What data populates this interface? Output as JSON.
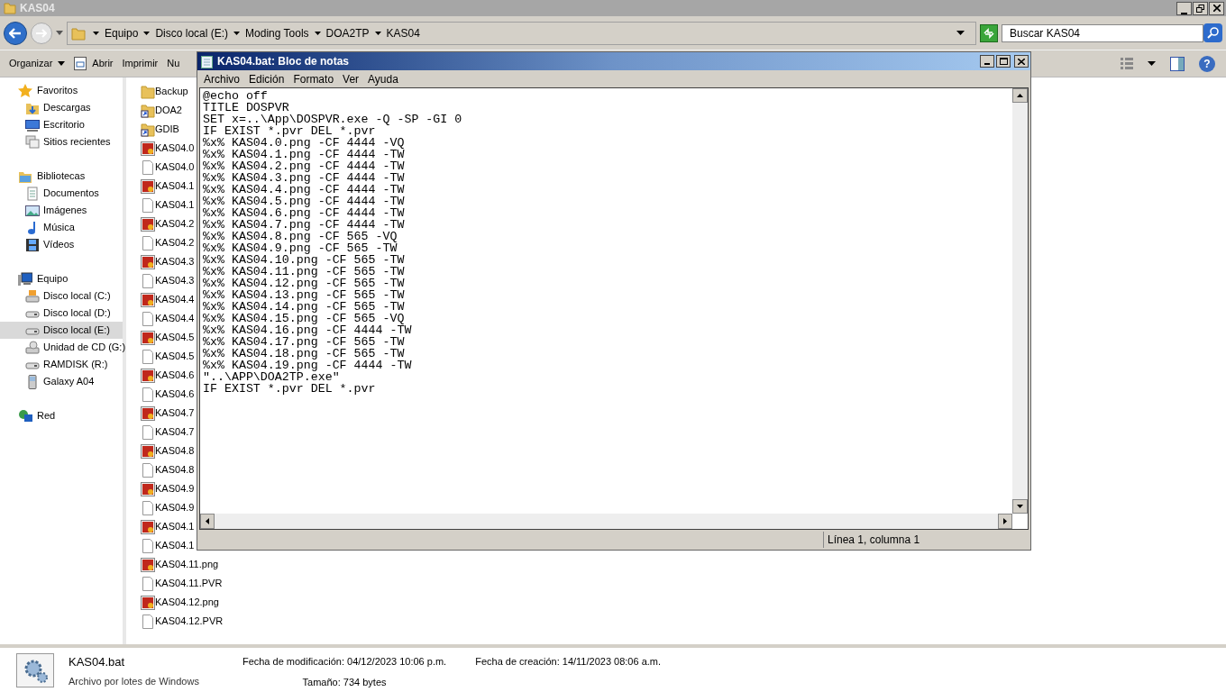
{
  "window": {
    "title": "KAS04"
  },
  "address_bar": {
    "crumbs": [
      "Equipo",
      "Disco local (E:)",
      "Moding Tools",
      "DOA2TP",
      "KAS04"
    ]
  },
  "search": {
    "placeholder": "Buscar KAS04"
  },
  "toolbar": {
    "items": [
      "Organizar",
      "Abrir",
      "Imprimir",
      "Nu"
    ],
    "help_button": "?"
  },
  "sidebar": {
    "groups": [
      {
        "label": "Favoritos",
        "kind": "star",
        "children": [
          {
            "label": "Descargas",
            "kind": "downloads",
            "selected": false
          },
          {
            "label": "Escritorio",
            "kind": "desktop",
            "selected": false
          },
          {
            "label": "Sitios recientes",
            "kind": "recent",
            "selected": false
          }
        ]
      },
      {
        "label": "Bibliotecas",
        "kind": "library",
        "children": [
          {
            "label": "Documentos",
            "kind": "docs",
            "selected": false
          },
          {
            "label": "Imágenes",
            "kind": "pictures",
            "selected": false
          },
          {
            "label": "Música",
            "kind": "music",
            "selected": false
          },
          {
            "label": "Vídeos",
            "kind": "video",
            "selected": false
          }
        ]
      },
      {
        "label": "Equipo",
        "kind": "computer",
        "children": [
          {
            "label": "Disco local (C:)",
            "kind": "sysdrive",
            "selected": false
          },
          {
            "label": "Disco local (D:)",
            "kind": "drive",
            "selected": false
          },
          {
            "label": "Disco local (E:)",
            "kind": "drive",
            "selected": true
          },
          {
            "label": "Unidad de CD (G:)",
            "kind": "cd",
            "selected": false
          },
          {
            "label": "RAMDISK (R:)",
            "kind": "drive",
            "selected": false
          },
          {
            "label": "Galaxy A04",
            "kind": "phone",
            "selected": false
          }
        ]
      },
      {
        "label": "Red",
        "kind": "network"
      }
    ]
  },
  "files": [
    {
      "name": "Backup",
      "kind": "folder"
    },
    {
      "name": "DOA2",
      "kind": "shortcut"
    },
    {
      "name": "GDIB",
      "kind": "shortcut"
    },
    {
      "name": "KAS04.0",
      "kind": "image"
    },
    {
      "name": "KAS04.0",
      "kind": "file"
    },
    {
      "name": "KAS04.1",
      "kind": "image"
    },
    {
      "name": "KAS04.1",
      "kind": "file"
    },
    {
      "name": "KAS04.2",
      "kind": "image"
    },
    {
      "name": "KAS04.2",
      "kind": "file"
    },
    {
      "name": "KAS04.3",
      "kind": "image"
    },
    {
      "name": "KAS04.3",
      "kind": "file"
    },
    {
      "name": "KAS04.4",
      "kind": "image"
    },
    {
      "name": "KAS04.4",
      "kind": "file"
    },
    {
      "name": "KAS04.5",
      "kind": "image"
    },
    {
      "name": "KAS04.5",
      "kind": "file"
    },
    {
      "name": "KAS04.6",
      "kind": "image"
    },
    {
      "name": "KAS04.6",
      "kind": "file"
    },
    {
      "name": "KAS04.7",
      "kind": "image"
    },
    {
      "name": "KAS04.7",
      "kind": "file"
    },
    {
      "name": "KAS04.8",
      "kind": "image"
    },
    {
      "name": "KAS04.8",
      "kind": "file"
    },
    {
      "name": "KAS04.9",
      "kind": "image"
    },
    {
      "name": "KAS04.9",
      "kind": "file"
    },
    {
      "name": "KAS04.1",
      "kind": "image"
    },
    {
      "name": "KAS04.1",
      "kind": "file"
    },
    {
      "name": "KAS04.11.png",
      "kind": "image"
    },
    {
      "name": "KAS04.11.PVR",
      "kind": "file"
    },
    {
      "name": "KAS04.12.png",
      "kind": "image"
    },
    {
      "name": "KAS04.12.PVR",
      "kind": "file"
    }
  ],
  "details": {
    "name": "KAS04.bat",
    "type": "Archivo por lotes de Windows",
    "fields": [
      {
        "label": "Fecha de modificación:",
        "value": "04/12/2023 10:06 p.m."
      },
      {
        "label": "Fecha de creación:",
        "value": "14/11/2023 08:06 a.m."
      },
      {
        "label": "Tamaño:",
        "value": "734 bytes"
      }
    ]
  },
  "notepad": {
    "title": "KAS04.bat: Bloc de notas",
    "menu": [
      "Archivo",
      "Edición",
      "Formato",
      "Ver",
      "Ayuda"
    ],
    "lines": [
      "@echo off",
      "TITLE DOSPVR",
      "SET x=..\\App\\DOSPVR.exe -Q -SP -GI 0",
      "IF EXIST *.pvr DEL *.pvr",
      "%x% KAS04.0.png -CF 4444 -VQ",
      "%x% KAS04.1.png -CF 4444 -TW",
      "%x% KAS04.2.png -CF 4444 -TW",
      "%x% KAS04.3.png -CF 4444 -TW",
      "%x% KAS04.4.png -CF 4444 -TW",
      "%x% KAS04.5.png -CF 4444 -TW",
      "%x% KAS04.6.png -CF 4444 -TW",
      "%x% KAS04.7.png -CF 4444 -TW",
      "%x% KAS04.8.png -CF 565 -VQ",
      "%x% KAS04.9.png -CF 565 -TW",
      "%x% KAS04.10.png -CF 565 -TW",
      "%x% KAS04.11.png -CF 565 -TW",
      "%x% KAS04.12.png -CF 565 -TW",
      "%x% KAS04.13.png -CF 565 -TW",
      "%x% KAS04.14.png -CF 565 -TW",
      "%x% KAS04.15.png -CF 565 -VQ",
      "%x% KAS04.16.png -CF 4444 -TW",
      "%x% KAS04.17.png -CF 565 -TW",
      "%x% KAS04.18.png -CF 565 -TW",
      "%x% KAS04.19.png -CF 4444 -TW",
      "\"..\\APP\\DOA2TP.exe\"",
      "IF EXIST *.pvr DEL *.pvr"
    ],
    "status": "Línea 1, columna 1"
  }
}
